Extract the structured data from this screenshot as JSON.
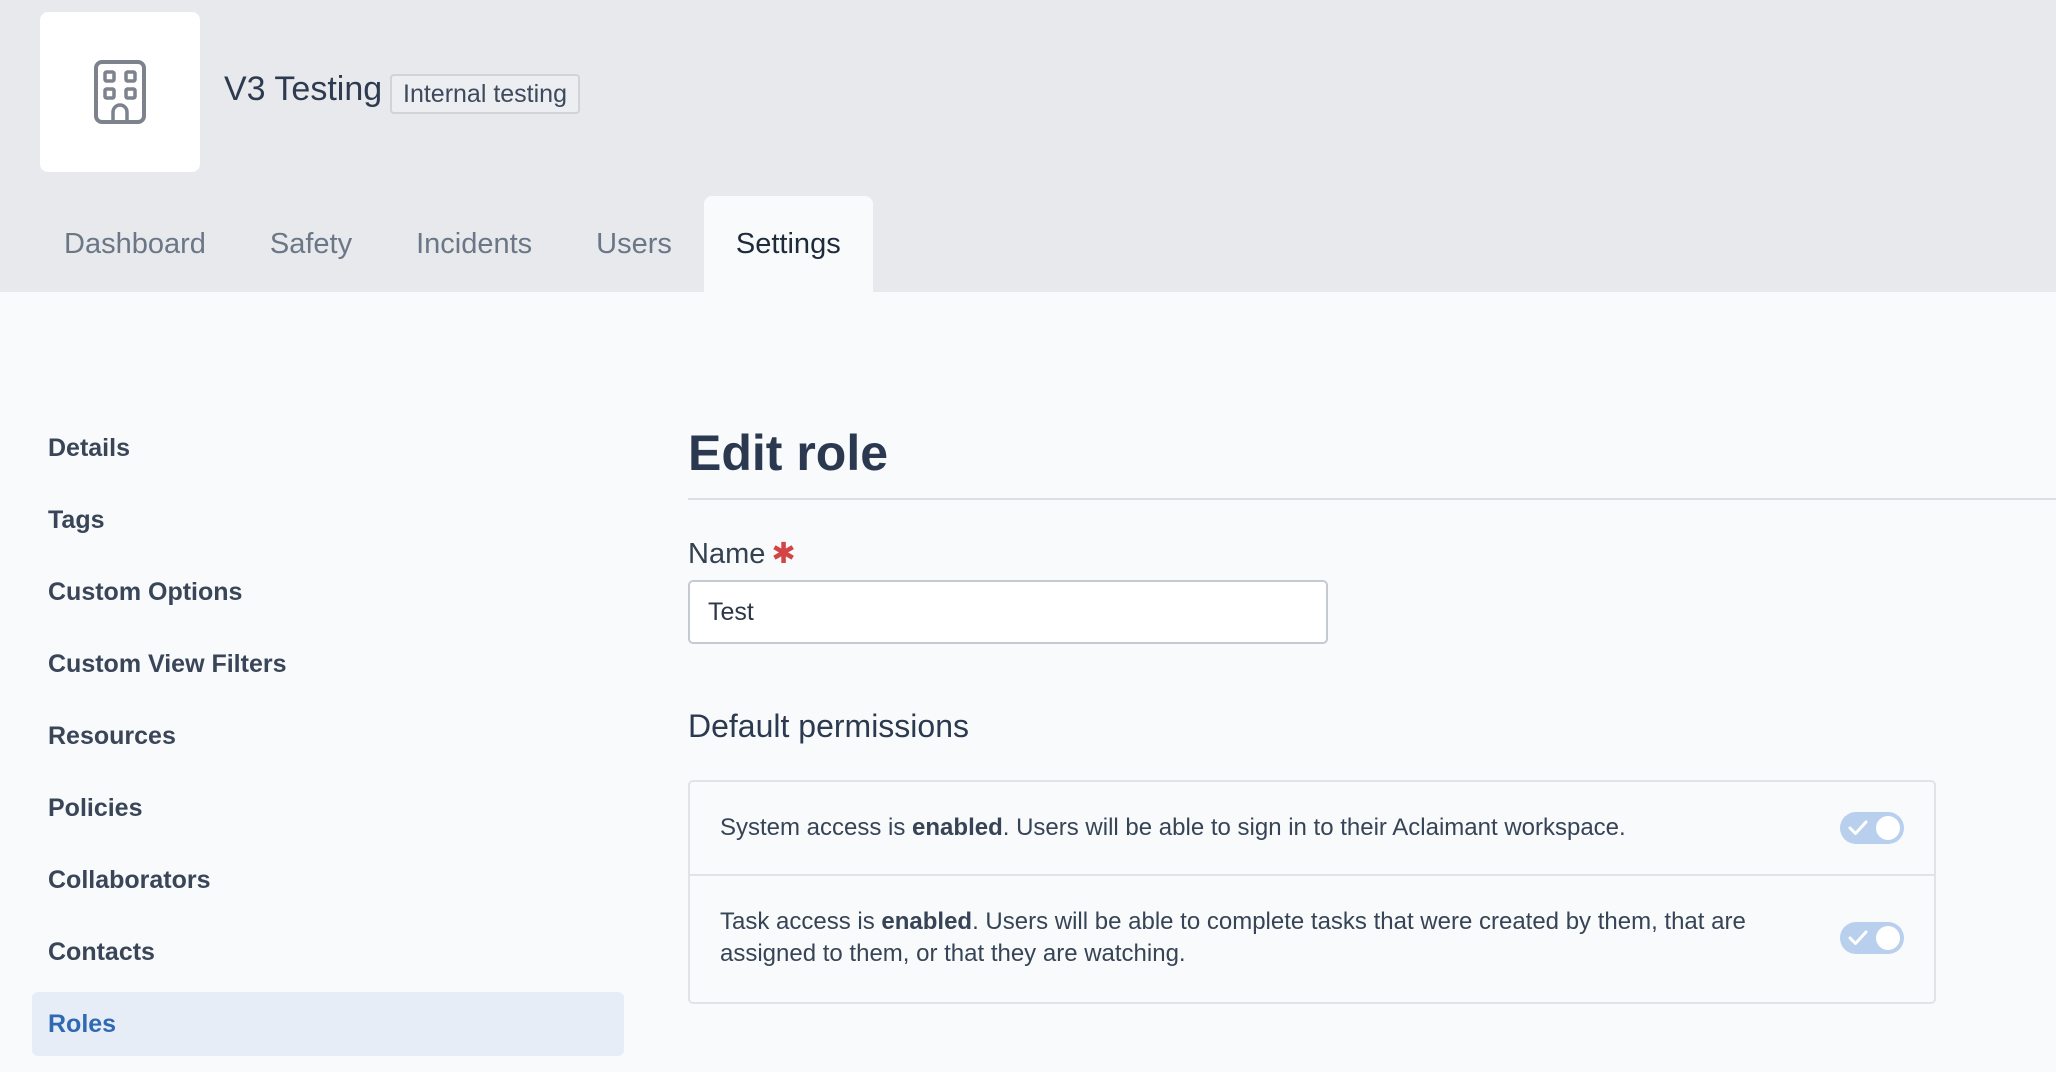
{
  "org": {
    "name": "V3 Testing",
    "badge": "Internal testing",
    "logo_icon": "building-icon"
  },
  "tabs": [
    {
      "label": "Dashboard"
    },
    {
      "label": "Safety"
    },
    {
      "label": "Incidents"
    },
    {
      "label": "Users"
    },
    {
      "label": "Settings",
      "active": true
    }
  ],
  "sidebar": {
    "items": [
      {
        "label": "Details"
      },
      {
        "label": "Tags"
      },
      {
        "label": "Custom Options"
      },
      {
        "label": "Custom View Filters"
      },
      {
        "label": "Resources"
      },
      {
        "label": "Policies"
      },
      {
        "label": "Collaborators"
      },
      {
        "label": "Contacts"
      },
      {
        "label": "Roles",
        "active": true
      }
    ]
  },
  "main": {
    "title": "Edit role",
    "name_field": {
      "label": "Name",
      "required_mark": "✱",
      "value": "Test"
    },
    "permissions": {
      "title": "Default permissions",
      "system_access": {
        "prefix": "System access is ",
        "state": "enabled",
        "suffix": ". Users will be able to sign in to their Aclaimant workspace.",
        "enabled": true
      },
      "task_access": {
        "prefix": "Task access is ",
        "state": "enabled",
        "suffix": ". Users will be able to complete tasks that were created by them, that are assigned to them, or that they are watching.",
        "enabled": true
      }
    }
  },
  "colors": {
    "accent": "#3069b3",
    "toggle_on": "#b8cfee",
    "required": "#d34545"
  }
}
